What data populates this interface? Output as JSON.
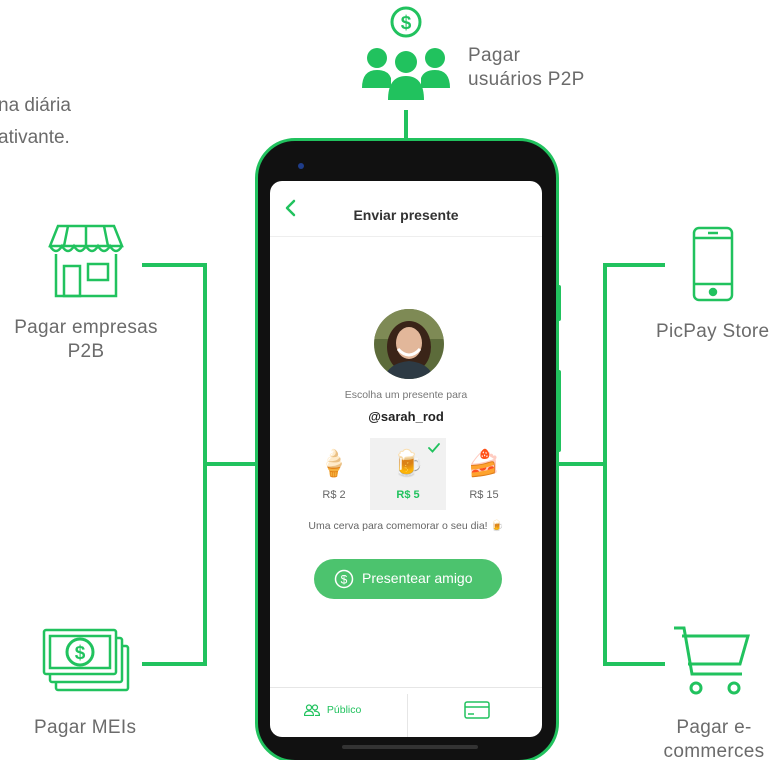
{
  "intro": {
    "line1": "na diária",
    "line2": "ativante."
  },
  "labels": {
    "p2p_line1": "Pagar",
    "p2p_line2": "usuários P2P",
    "p2b_line1": "Pagar empresas",
    "p2b_line2": "P2B",
    "store": "PicPay Store",
    "meis": "Pagar MEIs",
    "ecom_line1": "Pagar e-",
    "ecom_line2": "commerces"
  },
  "icons": [
    "dollar-users-icon",
    "storefront-icon",
    "smartphone-icon",
    "money-bills-icon",
    "shopping-cart-icon"
  ],
  "colors": {
    "accent": "#21c25e",
    "cta": "#4cc36e",
    "phone_body": "#111111"
  },
  "app": {
    "title": "Enviar presente",
    "prompt": "Escolha um presente para",
    "username": "@sarah_rod",
    "gifts": [
      {
        "emoji": "🍦",
        "price": "R$ 2",
        "selected": false
      },
      {
        "emoji": "🍺",
        "price": "R$ 5",
        "selected": true
      },
      {
        "emoji": "🍰",
        "price": "R$ 15",
        "selected": false
      }
    ],
    "message": "Uma cerva para comemorar o seu dia! 🍺",
    "cta_label": "Presentear amigo",
    "tab_public": "Público"
  }
}
